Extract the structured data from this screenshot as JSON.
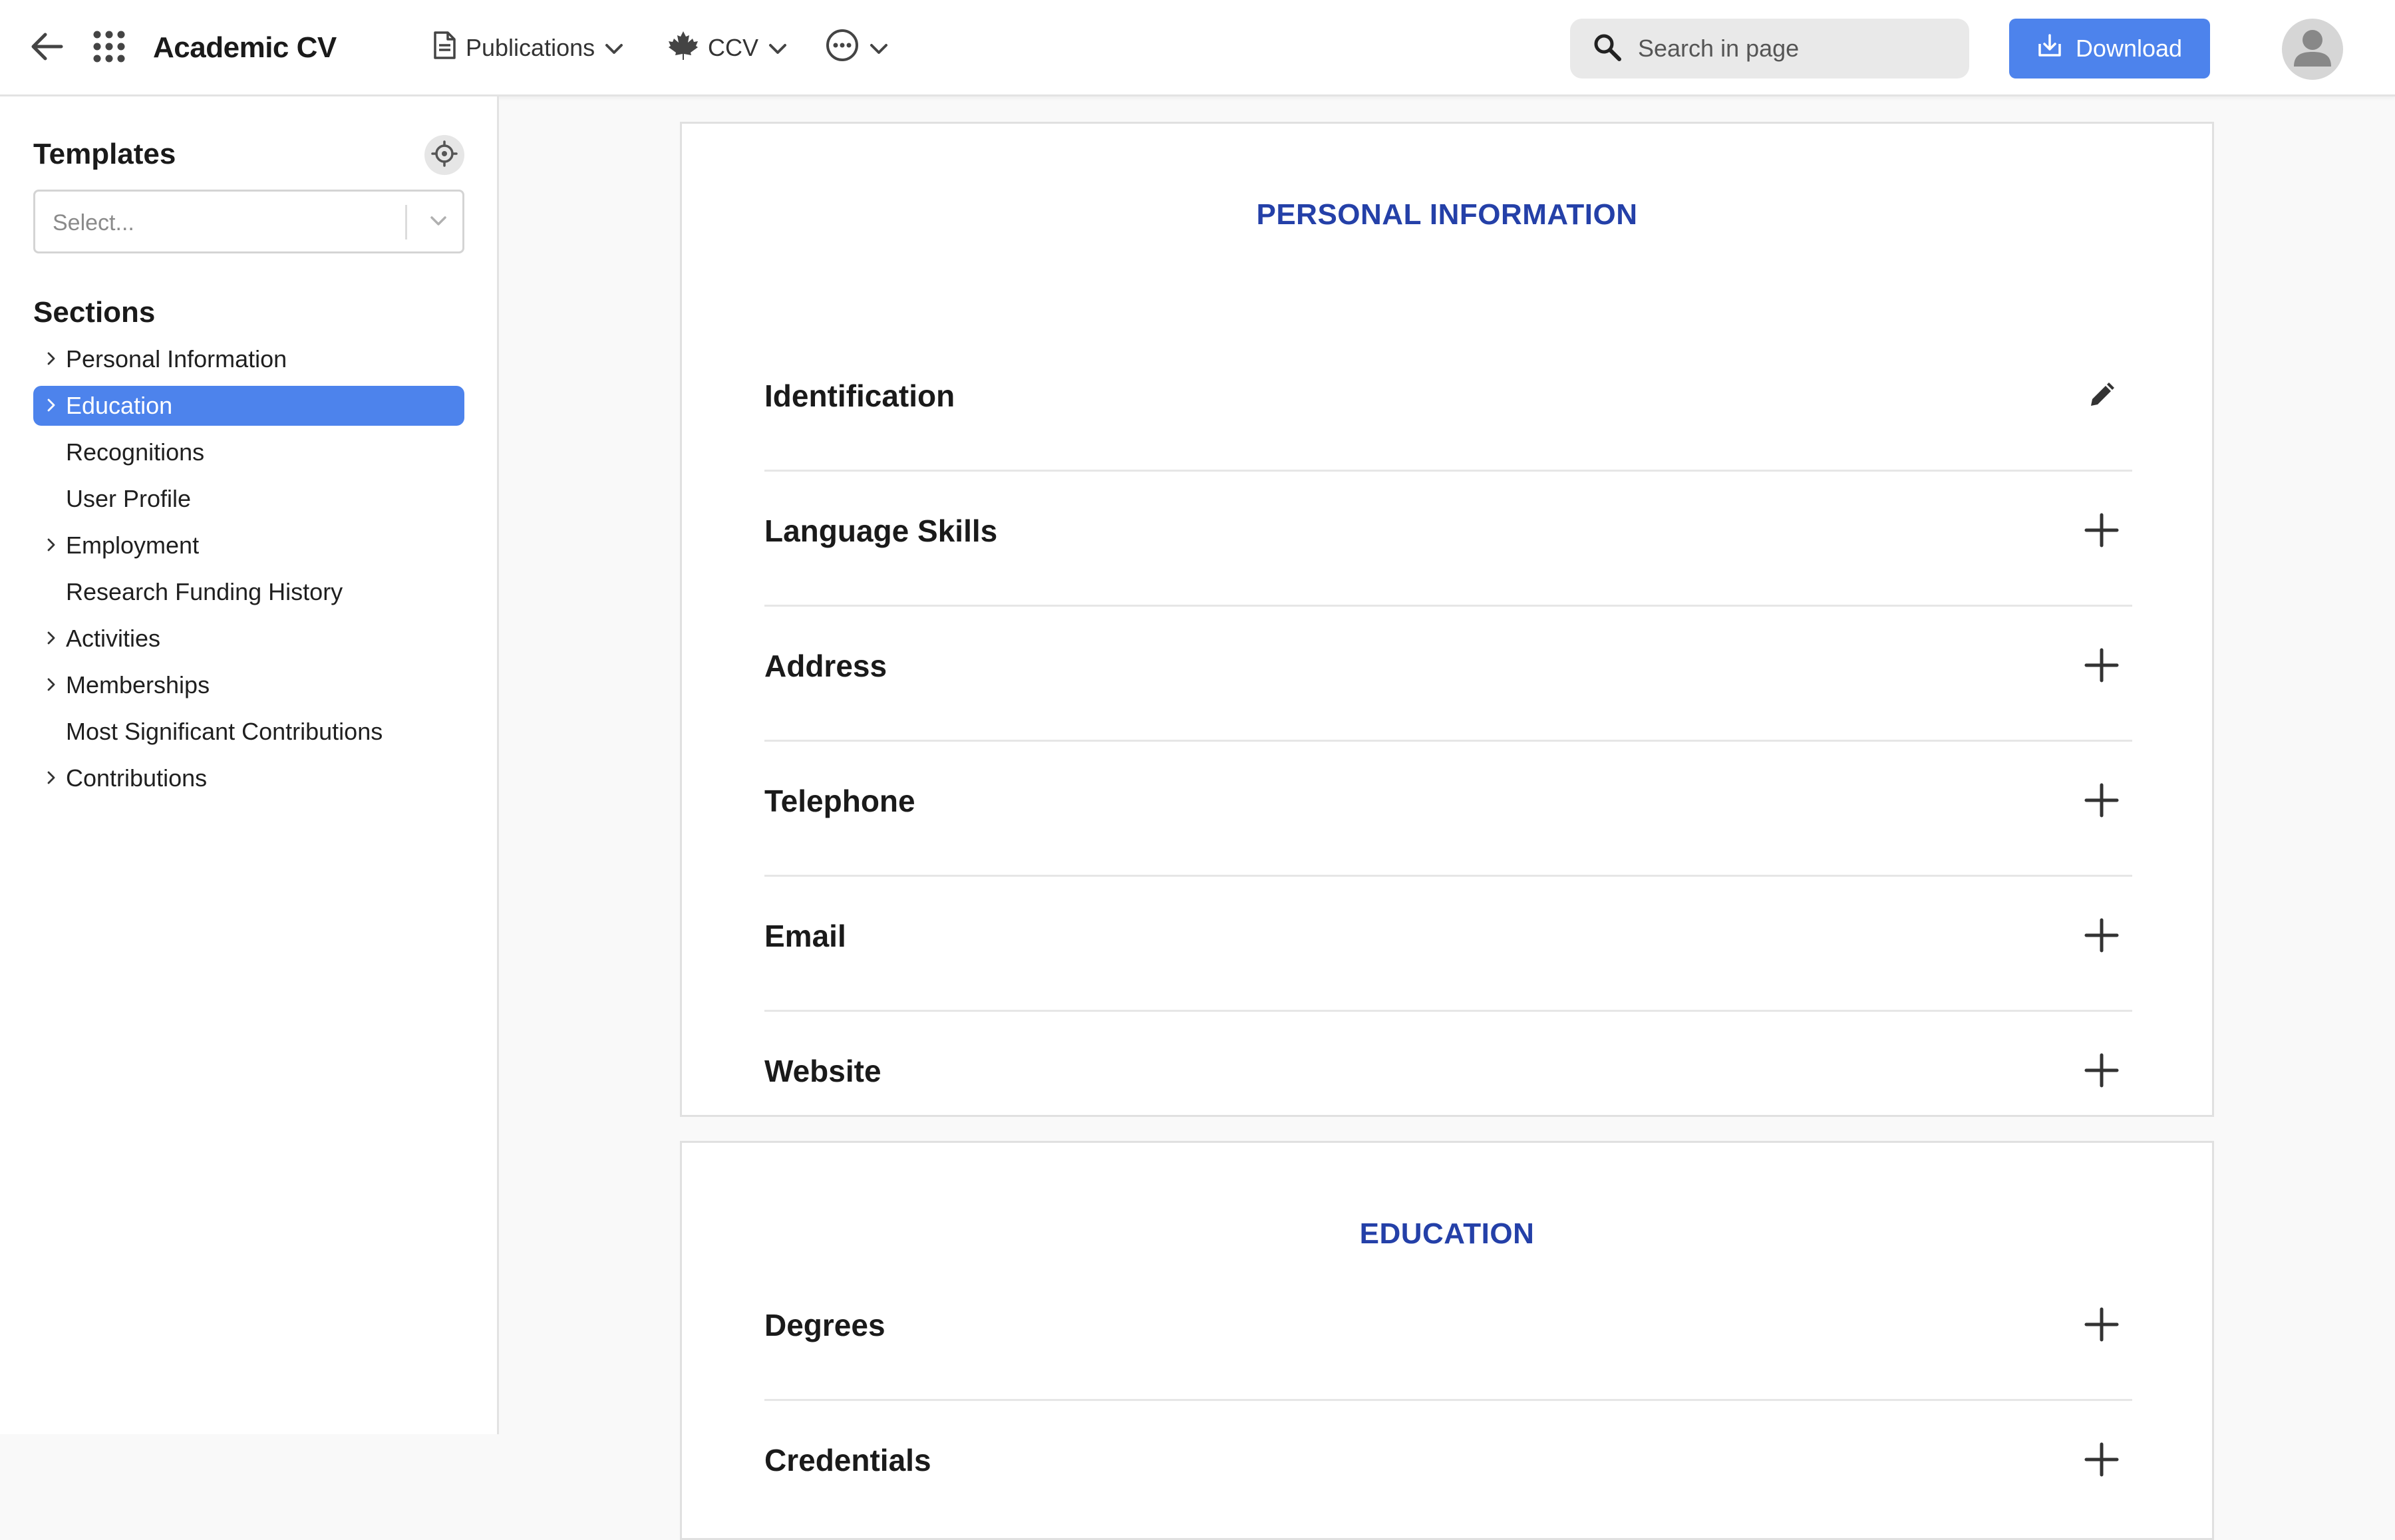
{
  "app": {
    "title": "Academic CV"
  },
  "topbar": {
    "menus": {
      "publications": "Publications",
      "ccv": "CCV"
    },
    "search": {
      "placeholder": "Search in page"
    },
    "download_label": "Download",
    "accent_color": "#4d83ec"
  },
  "sidebar": {
    "templates_heading": "Templates",
    "templates_select": {
      "placeholder": "Select..."
    },
    "sections_heading": "Sections",
    "items": [
      {
        "label": "Personal Information",
        "expandable": true,
        "active": false
      },
      {
        "label": "Education",
        "expandable": true,
        "active": true
      },
      {
        "label": "Recognitions",
        "expandable": false,
        "active": false
      },
      {
        "label": "User Profile",
        "expandable": false,
        "active": false
      },
      {
        "label": "Employment",
        "expandable": true,
        "active": false
      },
      {
        "label": "Research Funding History",
        "expandable": false,
        "active": false
      },
      {
        "label": "Activities",
        "expandable": true,
        "active": false
      },
      {
        "label": "Memberships",
        "expandable": true,
        "active": false
      },
      {
        "label": "Most Significant Contributions",
        "expandable": false,
        "active": false
      },
      {
        "label": "Contributions",
        "expandable": true,
        "active": false
      }
    ]
  },
  "main": {
    "personal_information": {
      "title": "PERSONAL INFORMATION",
      "rows": [
        {
          "label": "Identification",
          "action": "edit-icon"
        },
        {
          "label": "Language Skills",
          "action": "plus-icon"
        },
        {
          "label": "Address",
          "action": "plus-icon"
        },
        {
          "label": "Telephone",
          "action": "plus-icon"
        },
        {
          "label": "Email",
          "action": "plus-icon"
        },
        {
          "label": "Website",
          "action": "plus-icon"
        }
      ]
    },
    "education": {
      "title": "EDUCATION",
      "rows": [
        {
          "label": "Degrees",
          "action": "plus-icon"
        },
        {
          "label": "Credentials",
          "action": "plus-icon"
        }
      ]
    },
    "section_title_color": "#2440a8"
  }
}
